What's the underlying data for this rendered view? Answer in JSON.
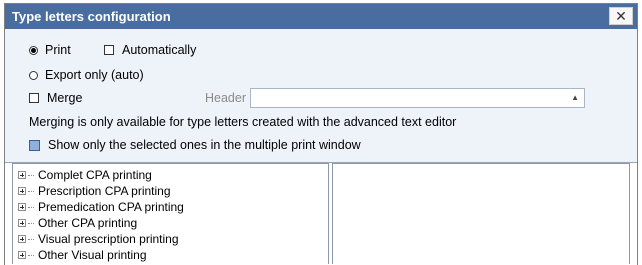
{
  "window": {
    "title": "Type letters configuration",
    "close_symbol": "✕"
  },
  "options": {
    "print_label": "Print",
    "print_selected": true,
    "automatically_label": "Automatically",
    "automatically_checked": false,
    "export_label": "Export only (auto)",
    "export_selected": false,
    "merge_label": "Merge",
    "merge_checked": false,
    "header_label": "Header",
    "header_value": "",
    "merge_note": "Merging is only available for type letters created with the advanced text editor",
    "show_selected_label": "Show only the selected ones in the multiple print window",
    "show_selected_checked": false
  },
  "tree": {
    "items": [
      {
        "label": "Complet CPA printing"
      },
      {
        "label": "Prescription CPA printing"
      },
      {
        "label": "Premedication CPA printing"
      },
      {
        "label": "Other CPA printing"
      },
      {
        "label": "Visual prescription printing"
      },
      {
        "label": "Other Visual printing"
      }
    ]
  },
  "icons": {
    "close": "close-icon",
    "expand": "expand-plus-icon",
    "dropdown": "dropdown-arrow-icon"
  },
  "colors": {
    "titlebar": "#496d9e",
    "panel": "#eef3fa",
    "accent_check": "#8fb1d9"
  }
}
